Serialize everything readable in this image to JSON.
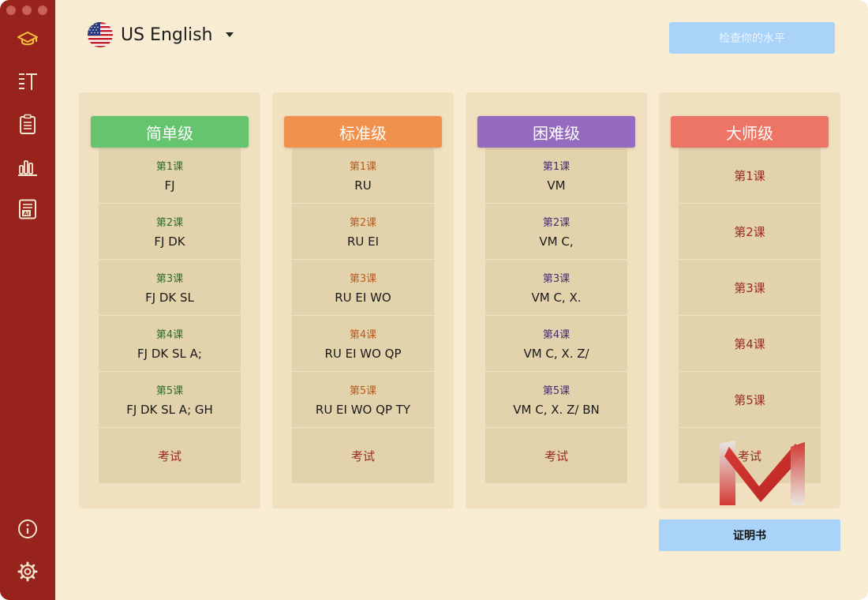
{
  "header": {
    "language": "US English",
    "check_level": "检查你的水平"
  },
  "sidebar": {
    "icons": [
      "graduation-cap-icon",
      "text-list-icon",
      "clipboard-icon",
      "bar-chart-icon",
      "ai-document-icon",
      "info-icon",
      "settings-icon"
    ]
  },
  "columns": [
    {
      "title": "简单级",
      "color": "#64c56e",
      "lesson_color": "#2e6b2c",
      "lessons": [
        {
          "label": "第1课",
          "keys": "FJ"
        },
        {
          "label": "第2课",
          "keys": "FJ DK"
        },
        {
          "label": "第3课",
          "keys": "FJ DK SL"
        },
        {
          "label": "第4课",
          "keys": "FJ DK SL A;"
        },
        {
          "label": "第5课",
          "keys": "FJ DK SL A; GH"
        }
      ],
      "exam": "考试"
    },
    {
      "title": "标准级",
      "color": "#f0924d",
      "lesson_color": "#b85a1e",
      "lessons": [
        {
          "label": "第1课",
          "keys": "RU"
        },
        {
          "label": "第2课",
          "keys": "RU EI"
        },
        {
          "label": "第3课",
          "keys": "RU EI WO"
        },
        {
          "label": "第4课",
          "keys": "RU EI WO QP"
        },
        {
          "label": "第5课",
          "keys": "RU EI WO QP TY"
        }
      ],
      "exam": "考试"
    },
    {
      "title": "困难级",
      "color": "#946bbe",
      "lesson_color": "#4a2a6e",
      "lessons": [
        {
          "label": "第1课",
          "keys": "VM"
        },
        {
          "label": "第2课",
          "keys": "VM C,"
        },
        {
          "label": "第3课",
          "keys": "VM C, X."
        },
        {
          "label": "第4课",
          "keys": "VM C, X. Z/"
        },
        {
          "label": "第5课",
          "keys": "VM C, X. Z/ BN"
        }
      ],
      "exam": "考试"
    },
    {
      "title": "大师级",
      "color": "#ec7565",
      "lesson_color": "#9a2b22",
      "lessons": [
        {
          "label": "第1课",
          "keys": ""
        },
        {
          "label": "第2课",
          "keys": ""
        },
        {
          "label": "第3课",
          "keys": ""
        },
        {
          "label": "第4课",
          "keys": ""
        },
        {
          "label": "第5课",
          "keys": ""
        }
      ],
      "exam": "考试"
    }
  ],
  "certificate": "证明书"
}
